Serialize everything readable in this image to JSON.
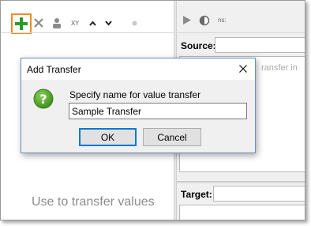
{
  "toolbar": {
    "add_icon": "plus-icon",
    "delete_icon": "x-icon",
    "user_icon": "person-icon",
    "xy_label": "XY",
    "move_up_icon": "chevron-up-icon",
    "move_down_icon": "chevron-down-icon",
    "dot_icon": "dot-icon",
    "accent": "#f08a24",
    "add_color": "#2a9a2a"
  },
  "left_pane": {
    "hint": "Use to transfer values"
  },
  "right_pane": {
    "run_icon": "play-icon",
    "toggle_icon": "half-circle-icon",
    "ns_label": "ns:",
    "source_label": "Source:",
    "source_placeholder": "ransfer in",
    "target_label": "Target:"
  },
  "dialog": {
    "title": "Add Transfer",
    "close_glyph": "✕",
    "prompt": "Specify name for value transfer",
    "name_value": "Sample Transfer",
    "ok_label": "OK",
    "cancel_label": "Cancel",
    "question_color": "#5aa02c"
  }
}
